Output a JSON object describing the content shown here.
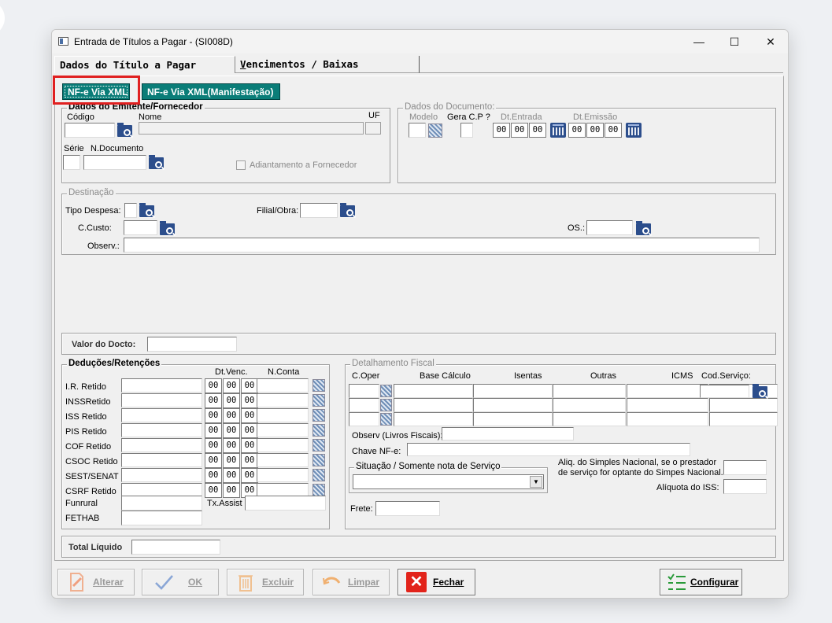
{
  "window": {
    "title": "Entrada de Títulos a Pagar - (SI008D)",
    "minimize": "—",
    "maximize": "☐",
    "close": "✕"
  },
  "tabs": [
    {
      "label": "Dados do Título a Pagar"
    },
    {
      "first_letter": "V",
      "rest": "encimentos / Baixas"
    }
  ],
  "xml_buttons": {
    "nfe_xml": "NF-e Via XML",
    "nfe_manifest": "NF-e Via XML(Manifestação)"
  },
  "emitente": {
    "title": "Dados do Emitente/Fornecedor",
    "codigo": "Código",
    "nome": "Nome",
    "uf": "UF",
    "serie": "Série",
    "ndoc": "N.Documento",
    "adiantamento": "Adiantamento a Fornecedor"
  },
  "documento": {
    "title": "Dados do Documento:",
    "modelo": "Modelo",
    "gera_cp": "Gera C.P ?",
    "dt_entrada": "Dt.Entrada",
    "dt_emissao": "Dt.Emissão",
    "date_part": "00"
  },
  "destinacao": {
    "title": "Destinação",
    "tipo_despesa": "Tipo Despesa:",
    "filial_obra": "Filial/Obra:",
    "ccusto": "C.Custo:",
    "os": "OS.:",
    "observ": "Observ.:"
  },
  "valor_docto": "Valor do Docto:",
  "deducoes": {
    "title": "Deduções/Retenções",
    "dt_venc": "Dt.Venc.",
    "nconta": "N.Conta",
    "rows": [
      "I.R. Retido",
      "INSSRetido",
      "ISS Retido",
      "PIS Retido",
      "COF Retido",
      "CSOC Retido",
      "SEST/SENAT",
      "CSRF Retido"
    ],
    "funrural": "Funrural",
    "fethab": "FETHAB",
    "tx_assist": "Tx.Assist"
  },
  "fiscal": {
    "title": "Detalhamento Fiscal",
    "columns": [
      "C.Oper",
      "Base Cálculo",
      "Isentas",
      "Outras",
      "ICMS",
      "Cod.Serviço:"
    ],
    "observ_livros": "Observ (Livros Fiscais):",
    "chave_nfe": "Chave NF-e:",
    "situacao": "Situação / Somente nota de Serviço",
    "aliq_simples_1": "Aliq. do Simples Nacional, se o prestador",
    "aliq_simples_2": "de serviço for optante do Simpes Nacional.",
    "aliquota_iss": "Alíquota do ISS:",
    "frete": "Frete:"
  },
  "total_liquido": "Total Líquido",
  "buttons": {
    "alterar": "Alterar",
    "ok": "OK",
    "excluir": "Excluir",
    "limpar": "Limpar",
    "fechar": "Fechar",
    "configurar": "Configurar"
  }
}
